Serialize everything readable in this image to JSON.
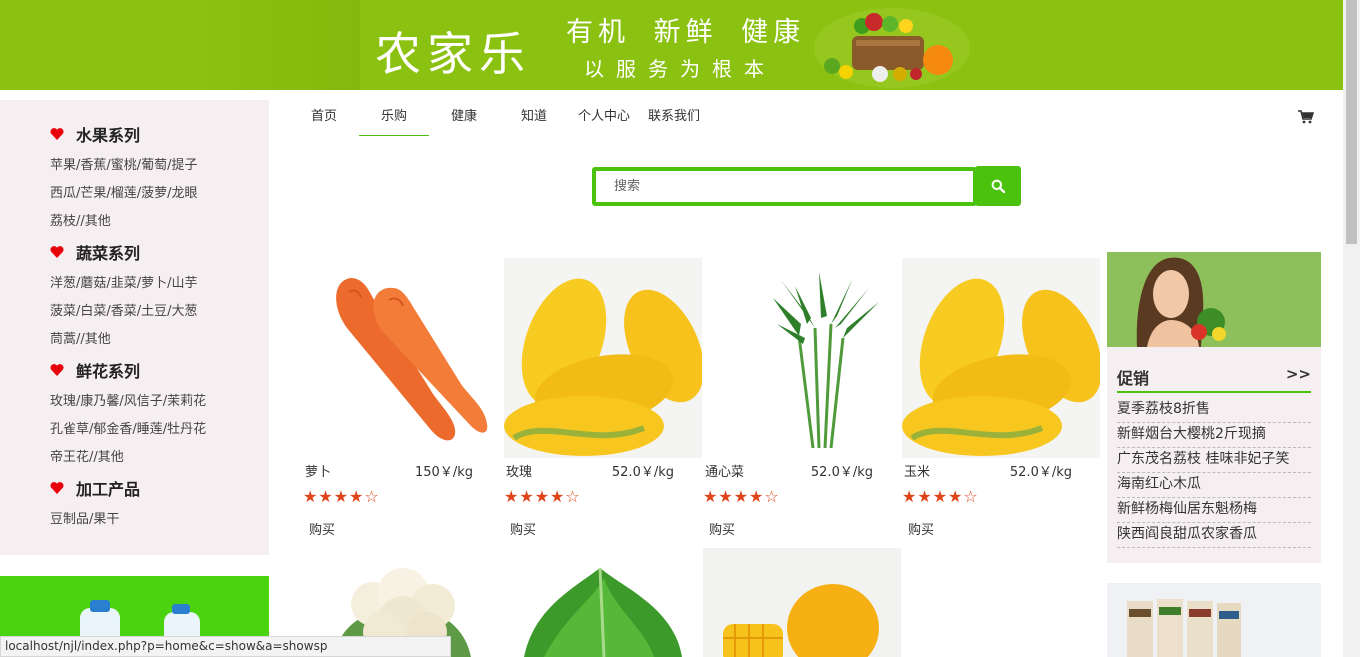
{
  "banner": {
    "logo_text": "农家乐",
    "slogan_top": "有机 新鲜 健康",
    "slogan_bottom": "以服务为根本"
  },
  "sidebar": {
    "categories": [
      {
        "title": "水果系列",
        "lines": [
          "苹果/香蕉/蜜桃/葡萄/提子",
          "西瓜/芒果/榴莲/菠萝/龙眼",
          "荔枝//其他"
        ]
      },
      {
        "title": "蔬菜系列",
        "lines": [
          "洋葱/蘑菇/韭菜/萝卜/山芋",
          "菠菜/白菜/香菜/土豆/大葱",
          "茼蒿//其他"
        ]
      },
      {
        "title": "鲜花系列",
        "lines": [
          "玫瑰/康乃馨/风信子/茉莉花",
          "孔雀草/郁金香/睡莲/牡丹花",
          "帝王花//其他"
        ]
      },
      {
        "title": "加工产品",
        "lines": [
          "豆制品/果干"
        ]
      }
    ]
  },
  "nav": {
    "items": [
      "首页",
      "乐购",
      "健康",
      "知道",
      "个人中心",
      "联系我们"
    ],
    "active": "乐购",
    "cart_icon": "shopping-cart-icon"
  },
  "search": {
    "placeholder": "搜索",
    "value": "",
    "button_icon": "search-icon"
  },
  "products": [
    {
      "name": "萝卜",
      "price": "150￥/kg",
      "stars": "★★★★☆",
      "buy_label": "购买",
      "image": "carrot"
    },
    {
      "name": "玫瑰",
      "price": "52.0￥/kg",
      "stars": "★★★★☆",
      "buy_label": "购买",
      "image": "corn"
    },
    {
      "name": "通心菜",
      "price": "52.0￥/kg",
      "stars": "★★★★☆",
      "buy_label": "购买",
      "image": "water-spinach"
    },
    {
      "name": "玉米",
      "price": "52.0￥/kg",
      "stars": "★★★★☆",
      "buy_label": "购买",
      "image": "corn"
    }
  ],
  "products_row2_images": [
    "cauliflower",
    "spinach",
    "mango"
  ],
  "promo": {
    "title": "促销",
    "more": ">>",
    "items": [
      "夏季荔枝8折售",
      "新鲜烟台大樱桃2斤现摘",
      "广东茂名荔枝 桂味非妃子笑",
      "海南红心木瓜",
      "新鲜杨梅仙居东魁杨梅",
      "陕西阎良甜瓜农家香瓜"
    ]
  },
  "status_bar": {
    "url": "localhost/njl/index.php?p=home&c=show&a=showsp"
  },
  "colors": {
    "banner_green": "#8bc110",
    "accent_green": "#4bc30e",
    "sidebar_bg": "#f6eff1",
    "heart_red": "#e8000b",
    "star_red": "#e0441a"
  }
}
